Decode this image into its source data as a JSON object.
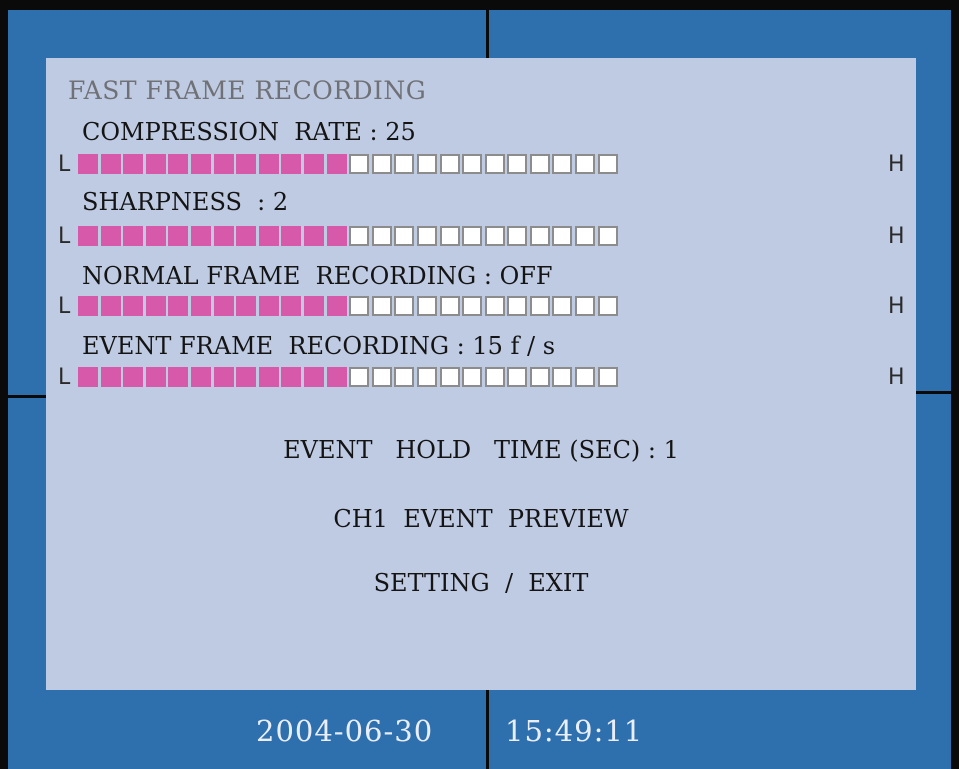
{
  "menu": {
    "title": "FAST FRAME RECORDING",
    "bar_end_low": "L",
    "bar_end_high": "H",
    "bar_total_cells": 24,
    "rows": [
      {
        "label": "COMPRESSION  RATE : 25",
        "filled_cells": 12
      },
      {
        "label": "SHARPNESS  : 2",
        "filled_cells": 12
      },
      {
        "label": "NORMAL FRAME  RECORDING : OFF",
        "filled_cells": 12
      },
      {
        "label": "EVENT FRAME  RECORDING : 15 f / s",
        "filled_cells": 12
      }
    ],
    "event_hold_time": "EVENT   HOLD   TIME (SEC) : 1",
    "event_preview": "CH1  EVENT  PREVIEW",
    "setting_exit": "SETTING  /  EXIT"
  },
  "status_bar": {
    "date": "2004-06-30",
    "time": "15:49:11"
  },
  "colors": {
    "screen_background": "#2e6fae",
    "panel_background": "#bfcbe3",
    "cell_filled": "#d65aa9",
    "cell_empty": "#ffffff",
    "title_text": "#6f7176",
    "status_text": "#e9eef8"
  }
}
